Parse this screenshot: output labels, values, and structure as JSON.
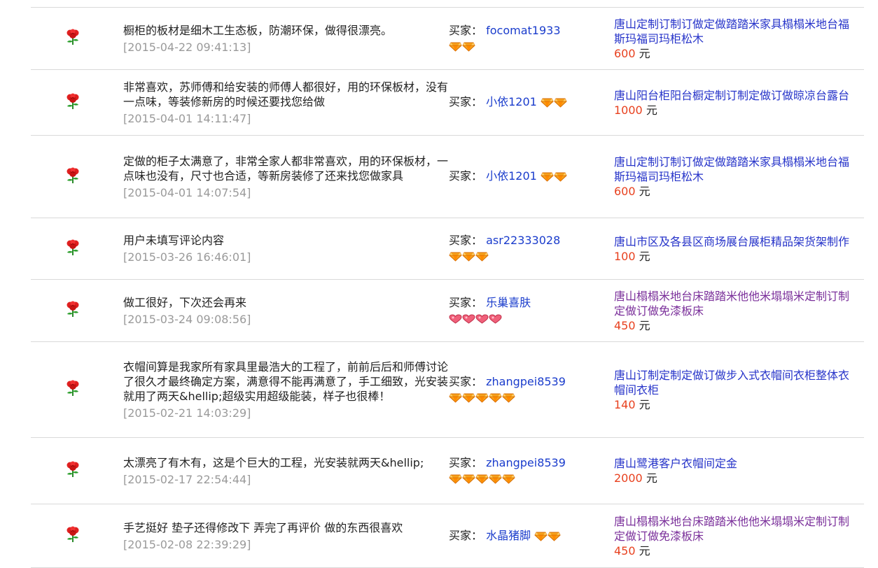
{
  "currency_unit": "元",
  "buyer_label": "买家：",
  "reviews": [
    {
      "comment": "橱柜的板材是细木工生态板，防潮环保，做得很漂亮。",
      "time": "[2015-04-22 09:41:13]",
      "buyer": "focomat1933",
      "badge_type": "diamond",
      "badge_count": 2,
      "badge_inline": false,
      "product": "唐山定制订制订做定做踏踏米家具榻榻米地台福斯玛福司玛柜松木",
      "product_visited": false,
      "price": "600"
    },
    {
      "comment": "非常喜欢，苏师傅和给安装的师傅人都很好，用的环保板材，没有一点味，等装修新房的时候还要找您给做",
      "time": "[2015-04-01 14:11:47]",
      "buyer": "小依1201",
      "badge_type": "diamond",
      "badge_count": 2,
      "badge_inline": true,
      "product": "唐山阳台柜阳台橱定制订制定做订做晾凉台露台",
      "product_visited": false,
      "price": "1000"
    },
    {
      "comment": "定做的柜子太满意了，非常全家人都非常喜欢，用的环保板材，一点味也没有，尺寸也合适，等新房装修了还来找您做家具",
      "time": "[2015-04-01 14:07:54]",
      "buyer": "小依1201",
      "badge_type": "diamond",
      "badge_count": 2,
      "badge_inline": true,
      "product": "唐山定制订制订做定做踏踏米家具榻榻米地台福斯玛福司玛柜松木",
      "product_visited": false,
      "price": "600"
    },
    {
      "comment": "用户未填写评论内容",
      "time": "[2015-03-26 16:46:01]",
      "buyer": "asr22333028",
      "badge_type": "diamond",
      "badge_count": 3,
      "badge_inline": false,
      "product": "唐山市区及各县区商场展台展柜精品架货架制作",
      "product_visited": false,
      "price": "100"
    },
    {
      "comment": "做工很好，下次还会再来",
      "time": "[2015-03-24 09:08:56]",
      "buyer": "乐巢喜肤",
      "badge_type": "heart",
      "badge_count": 4,
      "badge_inline": false,
      "product": "唐山榻榻米地台床踏踏米他他米塌塌米定制订制定做订做免漆板床",
      "product_visited": true,
      "price": "450"
    },
    {
      "comment": "衣帽间算是我家所有家具里最浩大的工程了，前前后后和师傅讨论了很久才最终确定方案，满意得不能再满意了，手工细致，光安装就用了两天&hellip;超级实用超级能装，样子也很棒！",
      "time": "[2015-02-21 14:03:29]",
      "buyer": "zhangpei8539",
      "badge_type": "diamond",
      "badge_count": 5,
      "badge_inline": false,
      "product": "唐山订制定制定做订做步入式衣帽间衣柜整体衣帽间衣柜",
      "product_visited": false,
      "price": "140"
    },
    {
      "comment": "太漂亮了有木有，这是个巨大的工程，光安装就两天&hellip;",
      "time": "[2015-02-17 22:54:44]",
      "buyer": "zhangpei8539",
      "badge_type": "diamond",
      "badge_count": 5,
      "badge_inline": false,
      "product": "唐山鹭港客户衣帽间定金",
      "product_visited": false,
      "price": "2000"
    },
    {
      "comment": "手艺挺好 垫子还得修改下 弄完了再评价 做的东西很喜欢",
      "time": "[2015-02-08 22:39:29]",
      "buyer": "水晶猪脚",
      "badge_type": "diamond",
      "badge_count": 2,
      "badge_inline": true,
      "product": "唐山榻榻米地台床踏踏米他他米塌塌米定制订制定做订做免漆板床",
      "product_visited": true,
      "price": "450"
    }
  ],
  "colors": {
    "price": "#e8411f",
    "link": "#2633c9",
    "visited": "#7a2f9a",
    "buyer_name": "#1a3ccc",
    "time": "#9a9a9a",
    "divider": "#d9d9d9"
  }
}
